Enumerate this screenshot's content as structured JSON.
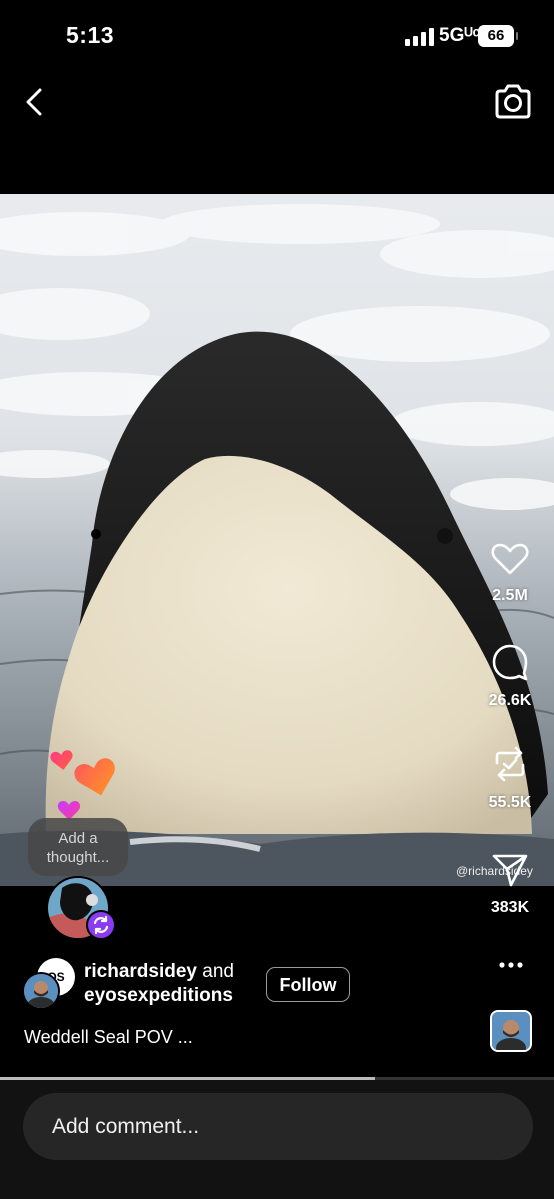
{
  "status_bar": {
    "time": "5:13",
    "network": "5Gᵁᶜ",
    "battery": "66"
  },
  "nav": {
    "back_icon": "chevron-left-icon",
    "camera_icon": "camera-icon"
  },
  "media": {
    "watermark": "@richardsidey"
  },
  "actions": {
    "likes": "2.5M",
    "comments": "26.6K",
    "reposts": "55.5K",
    "shares": "383K"
  },
  "thought_bubble": {
    "label": "Add a thought..."
  },
  "post": {
    "author_primary": "richardsidey",
    "and_text": "and",
    "author_secondary": "eyosexpeditions",
    "avatar_text": "OS",
    "follow_label": "Follow",
    "caption": "Weddell Seal POV ..."
  },
  "playback": {
    "progress": 0.677
  },
  "comment": {
    "placeholder": "Add comment..."
  },
  "colors": {
    "background": "#000000",
    "comment_bar": "#121212",
    "comment_input": "#262626",
    "repost_badge": "#8a3cf0"
  }
}
